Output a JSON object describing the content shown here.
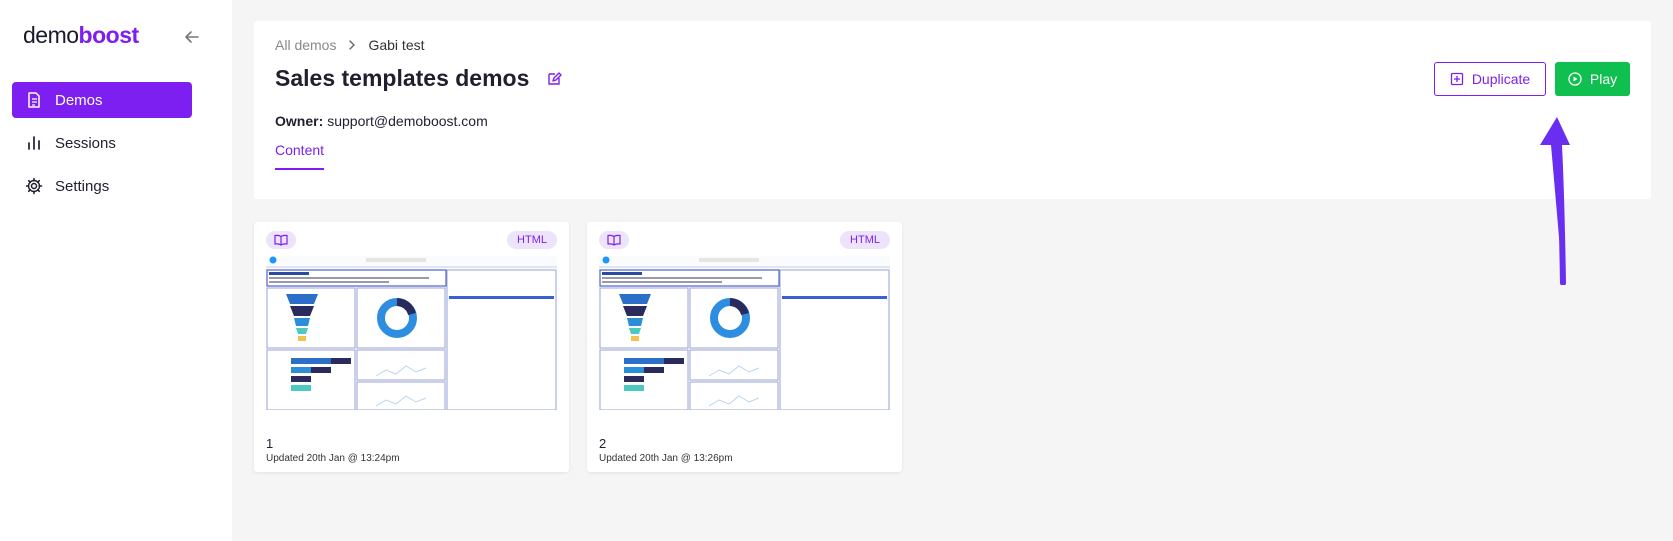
{
  "logo": {
    "part1": "demo",
    "part2": "boost"
  },
  "sidebar": {
    "items": [
      {
        "label": "Demos",
        "icon": "document-icon",
        "active": true
      },
      {
        "label": "Sessions",
        "icon": "bar-chart-icon",
        "active": false
      },
      {
        "label": "Settings",
        "icon": "gear-icon",
        "active": false
      }
    ]
  },
  "breadcrumb": {
    "parent": "All demos",
    "current": "Gabi test"
  },
  "page": {
    "title": "Sales templates demos",
    "owner_label": "Owner:",
    "owner_email": "support@demoboost.com",
    "tab": "Content"
  },
  "actions": {
    "duplicate": "Duplicate",
    "play": "Play"
  },
  "cards": [
    {
      "name": "1",
      "badge": "HTML",
      "updated": "Updated 20th Jan @ 13:24pm"
    },
    {
      "name": "2",
      "badge": "HTML",
      "updated": "Updated 20th Jan @ 13:26pm"
    }
  ],
  "colors": {
    "accent": "#7c1ff0",
    "play": "#0fbf4f",
    "arrow": "#6a2ef0"
  }
}
